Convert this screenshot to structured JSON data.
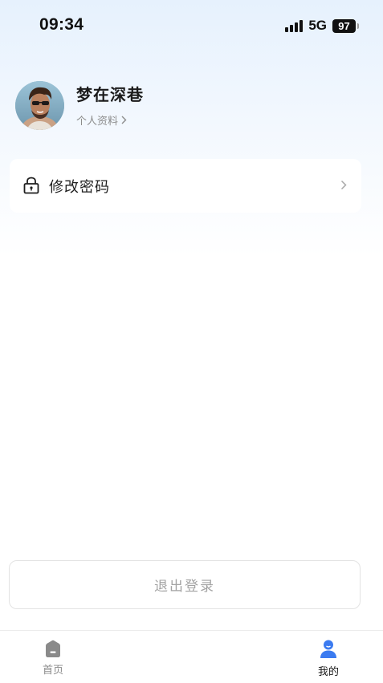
{
  "status_bar": {
    "time": "09:34",
    "network": "5G",
    "battery": "97"
  },
  "profile": {
    "name": "梦在深巷",
    "link_label": "个人资料"
  },
  "menu": {
    "items": [
      {
        "label": "修改密码",
        "icon": "lock-icon"
      }
    ]
  },
  "logout": {
    "label": "退出登录"
  },
  "tab_bar": {
    "tabs": [
      {
        "label": "首页",
        "icon": "home-icon",
        "active": false
      },
      {
        "label": "我的",
        "icon": "user-icon",
        "active": true
      }
    ]
  },
  "colors": {
    "accent_blue": "#3b7bf0",
    "inactive_gray": "#8a8a8a"
  }
}
